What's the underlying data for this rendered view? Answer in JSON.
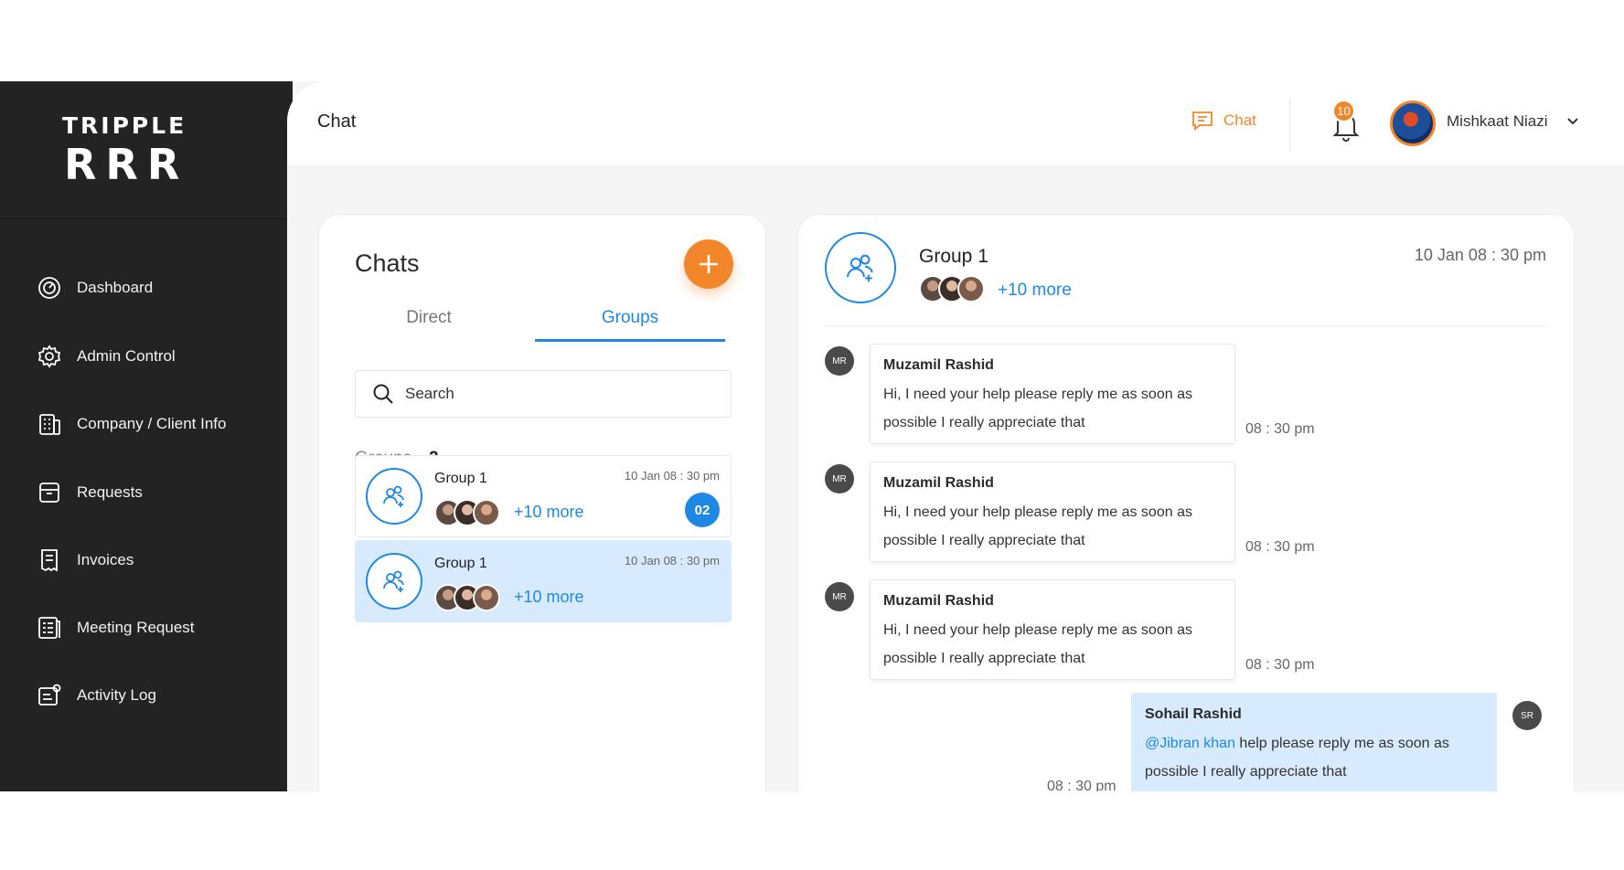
{
  "sidebar": {
    "logo_line1": "TRIPPLE",
    "logo_line2": "RRR",
    "items": [
      {
        "label": "Dashboard",
        "icon": "gauge-icon"
      },
      {
        "label": "Admin Control",
        "icon": "gear-icon"
      },
      {
        "label": "Company / Client Info",
        "icon": "building-icon"
      },
      {
        "label": "Requests",
        "icon": "archive-icon"
      },
      {
        "label": "Invoices",
        "icon": "invoice-icon"
      },
      {
        "label": "Meeting Request",
        "icon": "clipboard-icon"
      },
      {
        "label": "Activity Log",
        "icon": "activity-icon"
      }
    ]
  },
  "header": {
    "title": "Chat",
    "chat_label": "Chat",
    "notification_count": "10",
    "user_name": "Mishkaat Niazi"
  },
  "chats": {
    "title": "Chats",
    "tabs": [
      "Direct",
      "Groups"
    ],
    "active_tab": "Groups",
    "search_placeholder": "Search",
    "groups_label": "Groups",
    "groups_count": "2",
    "list": [
      {
        "name": "Group 1",
        "time": "10 Jan 08 : 30 pm",
        "more": "+10 more",
        "unread": "02"
      },
      {
        "name": "Group 1",
        "time": "10 Jan 08 : 30 pm",
        "more": "+10 more",
        "unread": ""
      }
    ]
  },
  "conversation": {
    "name": "Group 1",
    "more": "+10 more",
    "time": "10 Jan 08 : 30 pm",
    "messages": [
      {
        "initials": "MR",
        "sender": "Muzamil Rashid",
        "text_line1": "Hi, I need your help please reply me as soon as",
        "text_line2": "possible I really appreciate that",
        "time": "08 : 30 pm"
      },
      {
        "initials": "MR",
        "sender": "Muzamil Rashid",
        "text_line1": "Hi, I need your help please reply me as soon as",
        "text_line2": "possible I really appreciate that",
        "time": "08 : 30 pm"
      },
      {
        "initials": "MR",
        "sender": "Muzamil Rashid",
        "text_line1": "Hi, I need your help please reply me as soon as",
        "text_line2": "possible I really appreciate that",
        "time": "08 : 30 pm"
      },
      {
        "initials": "SR",
        "sender": "Sohail Rashid",
        "mention": "@Jibran khan",
        "text_line1": " help please reply me as soon as",
        "text_line2": "possible I really appreciate that",
        "time": "08 : 30 pm"
      }
    ]
  },
  "colors": {
    "sidebar_bg": "#232323",
    "accent_orange": "#f2862b",
    "accent_blue": "#1e88e5",
    "active_card_bg": "#d8eafd"
  }
}
